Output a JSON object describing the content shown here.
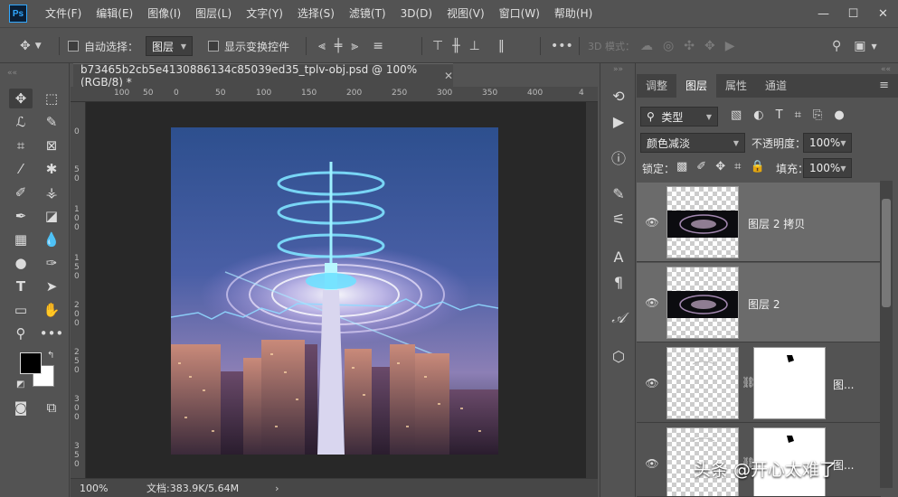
{
  "app": {
    "logo": "Ps"
  },
  "menu": [
    "文件(F)",
    "编辑(E)",
    "图像(I)",
    "图层(L)",
    "文字(Y)",
    "选择(S)",
    "滤镜(T)",
    "3D(D)",
    "视图(V)",
    "窗口(W)",
    "帮助(H)"
  ],
  "window_controls": {
    "minimize": "—",
    "maximize": "☐",
    "close": "✕"
  },
  "options": {
    "auto_select_label": "自动选择：",
    "auto_select_target": "图层",
    "show_transform_label": "显示变换控件",
    "mode_3d_label": "3D 模式："
  },
  "document": {
    "tab_title": "b73465b2cb5e4130886134c85039ed35_tplv-obj.psd @ 100%(RGB/8) *",
    "close": "✕"
  },
  "ruler": {
    "h_ticks": [
      "100",
      "50",
      "0",
      "50",
      "100",
      "150",
      "200",
      "250",
      "300",
      "350",
      "400",
      "4"
    ],
    "v_ticks": [
      "0",
      "5",
      "0",
      "1",
      "0",
      "0",
      "1",
      "5",
      "0",
      "2",
      "0",
      "0",
      "2",
      "5",
      "0",
      "3",
      "0",
      "0",
      "3",
      "5",
      "0"
    ]
  },
  "status": {
    "zoom": "100%",
    "doc_size": "文档:383.9K/5.64M",
    "arrow": "›"
  },
  "panel": {
    "tabs": [
      "调整",
      "图层",
      "属性",
      "通道"
    ],
    "active_tab": "图层",
    "filter_kind": "类型",
    "blend_mode": "颜色减淡",
    "opacity_label": "不透明度：",
    "opacity_value": "100%",
    "lock_label": "锁定：",
    "fill_label": "填充：",
    "fill_value": "100%"
  },
  "layers": [
    {
      "name": "图层 2 拷贝",
      "selected": true
    },
    {
      "name": "图层 2",
      "selected": true
    },
    {
      "name": "图...",
      "selected": false
    },
    {
      "name": "图...",
      "selected": false
    }
  ],
  "watermark": "头条 @开心太难了",
  "colors": {
    "foreground": "#000000",
    "background": "#ffffff",
    "accent": "#31a8ff"
  }
}
